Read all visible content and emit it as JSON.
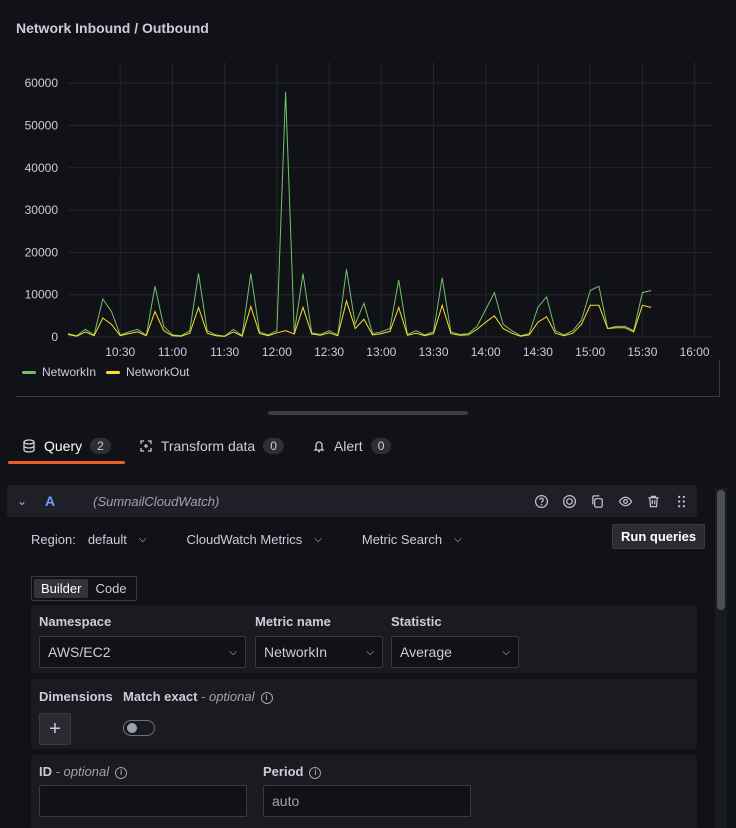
{
  "panel": {
    "title": "Network Inbound / Outbound"
  },
  "chart_data": {
    "type": "line",
    "x_ticks": [
      "10:30",
      "11:00",
      "11:30",
      "12:00",
      "12:30",
      "13:00",
      "13:30",
      "14:00",
      "14:30",
      "15:00",
      "15:30",
      "16:00"
    ],
    "y_ticks": [
      "0",
      "10000",
      "20000",
      "30000",
      "40000",
      "50000",
      "60000"
    ],
    "ylim": [
      0,
      65000
    ],
    "grid": true,
    "legend_placement": "bottom-left",
    "x_minutes": [
      10.0,
      10.05,
      10.1,
      10.15,
      10.2,
      10.25,
      10.3,
      10.35,
      10.4,
      10.45,
      10.5,
      10.55,
      11.0,
      11.05,
      11.1,
      11.15,
      11.2,
      11.25,
      11.3,
      11.35,
      11.4,
      11.45,
      11.5,
      11.55,
      12.0,
      12.05,
      12.1,
      12.15,
      12.2,
      12.25,
      12.3,
      12.35,
      12.4,
      12.45,
      12.5,
      12.55,
      13.0,
      13.05,
      13.1,
      13.15,
      13.2,
      13.25,
      13.3,
      13.35,
      13.4,
      13.45,
      13.5,
      13.55,
      14.0,
      14.05,
      14.1,
      14.15,
      14.2,
      14.25,
      14.3,
      14.35,
      14.4,
      14.45,
      14.5,
      14.55,
      15.0,
      15.05,
      15.1,
      15.15,
      15.2,
      15.25,
      15.3,
      15.35,
      15.4,
      15.45,
      15.5,
      15.55,
      16.0,
      16.05
    ],
    "series": [
      {
        "name": "NetworkIn",
        "color": "#73bf69",
        "values": [
          800,
          300,
          1800,
          500,
          9000,
          6000,
          500,
          1200,
          1800,
          400,
          12000,
          2500,
          500,
          300,
          1500,
          15000,
          1500,
          500,
          200,
          1800,
          300,
          15000,
          1200,
          500,
          1500,
          58000,
          1000,
          15000,
          1000,
          600,
          1500,
          500,
          16000,
          3000,
          8000,
          800,
          1200,
          2000,
          13500,
          600,
          1500,
          500,
          1200,
          14000,
          1200,
          600,
          800,
          2500,
          6500,
          10500,
          3000,
          1500,
          300,
          800,
          7000,
          9500,
          1500,
          500,
          1500,
          4000,
          11000,
          12000,
          2000,
          2500,
          2500,
          1500,
          10500,
          11000,
          null,
          null,
          null,
          null,
          null,
          null
        ]
      },
      {
        "name": "NetworkOut",
        "color": "#fade2a",
        "values": [
          600,
          200,
          1200,
          300,
          4500,
          3000,
          300,
          800,
          1200,
          300,
          6000,
          1500,
          300,
          200,
          900,
          7000,
          900,
          300,
          150,
          1200,
          200,
          7200,
          800,
          300,
          1000,
          1500,
          700,
          7000,
          700,
          400,
          1000,
          300,
          8500,
          2000,
          4200,
          500,
          800,
          1300,
          7000,
          400,
          900,
          300,
          800,
          7500,
          800,
          400,
          500,
          1800,
          3500,
          5000,
          2000,
          900,
          200,
          500,
          3500,
          4800,
          900,
          300,
          900,
          3000,
          7500,
          7500,
          2000,
          2200,
          2200,
          1200,
          7500,
          7000,
          null,
          null,
          null,
          null,
          null,
          null
        ]
      }
    ]
  },
  "legend": [
    {
      "label": "NetworkIn",
      "color": "#73bf69"
    },
    {
      "label": "NetworkOut",
      "color": "#fade2a"
    }
  ],
  "tabs": [
    {
      "label": "Query",
      "count": "2"
    },
    {
      "label": "Transform data",
      "count": "0"
    },
    {
      "label": "Alert",
      "count": "0"
    }
  ],
  "query": {
    "ref": "A",
    "datasource": "(SumnailCloudWatch)",
    "region_label": "Region:",
    "region_value": "default",
    "service": "CloudWatch Metrics",
    "mode": "Metric Search",
    "run_label": "Run queries",
    "builder_label": "Builder",
    "code_label": "Code",
    "namespace_label": "Namespace",
    "namespace_value": "AWS/EC2",
    "metric_label": "Metric name",
    "metric_value": "NetworkIn",
    "statistic_label": "Statistic",
    "statistic_value": "Average",
    "dimensions_label": "Dimensions",
    "match_exact_label": "Match exact",
    "optional_label": " - optional",
    "id_label": "ID",
    "id_value": "",
    "period_label": "Period",
    "period_placeholder": "auto"
  },
  "colors": {
    "accent": "#f05a28",
    "ref": "#6e9fff"
  }
}
